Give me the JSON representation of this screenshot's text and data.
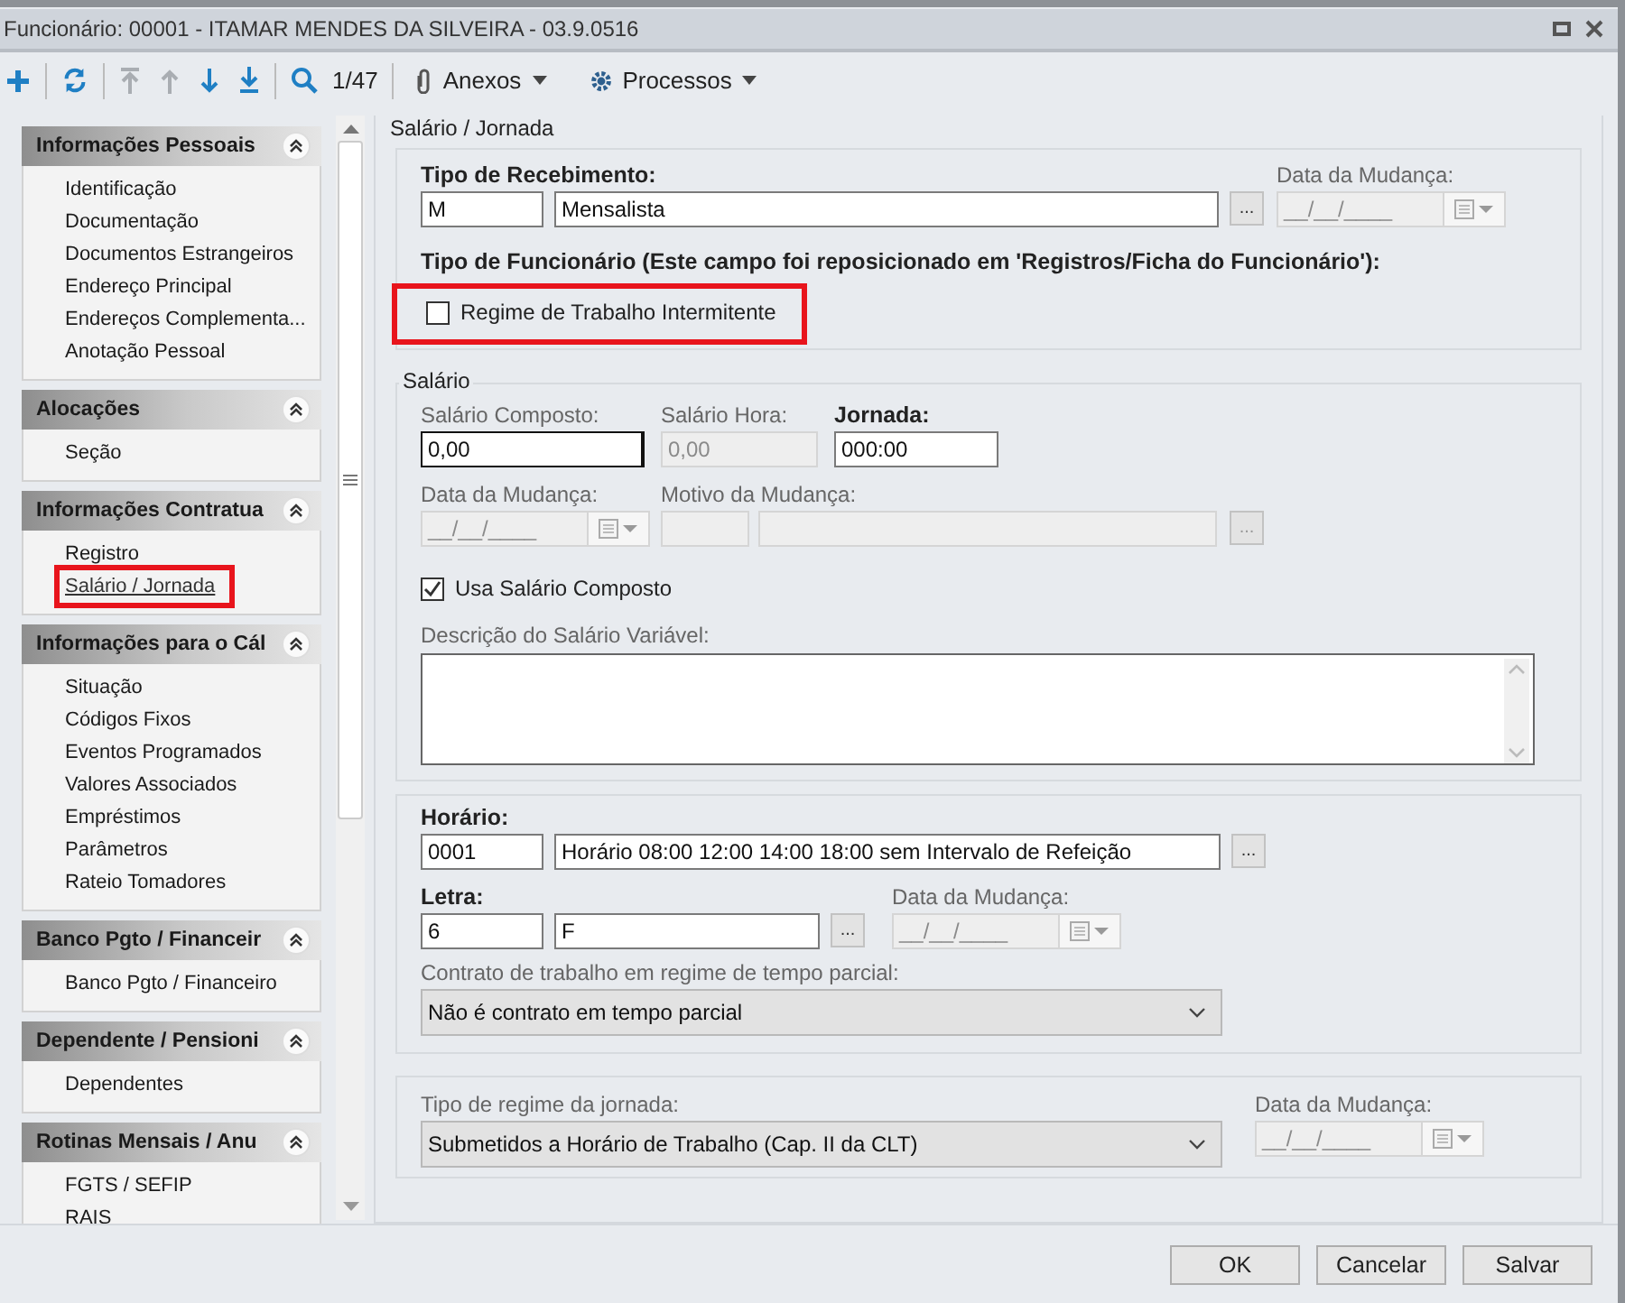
{
  "window": {
    "title": "Funcionário: 00001 - ITAMAR MENDES DA SILVEIRA - 03.9.0516"
  },
  "toolbar": [
    {
      "kind": "add",
      "disabled": false
    },
    {
      "kind": "refresh",
      "disabled": false
    },
    {
      "kind": "first",
      "disabled": true
    },
    {
      "kind": "previous",
      "disabled": true
    },
    {
      "kind": "next",
      "disabled": false
    },
    {
      "kind": "last",
      "disabled": false
    },
    {
      "kind": "search",
      "disabled": false
    },
    {
      "kind": "counter",
      "label": "1/47"
    },
    {
      "kind": "attachments",
      "label": "Anexos"
    },
    {
      "kind": "processes",
      "label": "Processos"
    }
  ],
  "sidebar": {
    "sections": [
      {
        "title": "Informações Pessoais",
        "expanded": true,
        "items": [
          {
            "label": "Identificação",
            "selected": false
          },
          {
            "label": "Documentação",
            "selected": false
          },
          {
            "label": "Documentos Estrangeiros",
            "selected": false
          },
          {
            "label": "Endereço Principal",
            "selected": false
          },
          {
            "label": "Endereços Complementa...",
            "selected": false
          },
          {
            "label": "Anotação Pessoal",
            "selected": false
          }
        ]
      },
      {
        "title": "Alocações",
        "expanded": true,
        "items": [
          {
            "label": "Seção",
            "selected": false
          }
        ]
      },
      {
        "title": "Informações Contratua",
        "expanded": true,
        "items": [
          {
            "label": "Registro",
            "selected": false
          },
          {
            "label": "Salário / Jornada",
            "selected": true,
            "highlighted": true
          }
        ]
      },
      {
        "title": "Informações para o Cál",
        "expanded": true,
        "items": [
          {
            "label": "Situação",
            "selected": false
          },
          {
            "label": "Códigos Fixos",
            "selected": false
          },
          {
            "label": "Eventos Programados",
            "selected": false
          },
          {
            "label": "Valores Associados",
            "selected": false
          },
          {
            "label": "Empréstimos",
            "selected": false
          },
          {
            "label": "Parâmetros",
            "selected": false
          },
          {
            "label": "Rateio Tomadores",
            "selected": false
          }
        ]
      },
      {
        "title": "Banco Pgto / Financeir",
        "expanded": true,
        "items": [
          {
            "label": "Banco Pgto / Financeiro",
            "selected": false
          }
        ]
      },
      {
        "title": "Dependente / Pensioni",
        "expanded": true,
        "items": [
          {
            "label": "Dependentes",
            "selected": false
          }
        ]
      },
      {
        "title": "Rotinas Mensais / Anu",
        "expanded": true,
        "items": [
          {
            "label": "FGTS / SEFIP",
            "selected": false
          },
          {
            "label": "RAIS",
            "selected": false
          }
        ]
      }
    ]
  },
  "form": {
    "legend": "Salário / Jornada",
    "recebimento": {
      "label": "Tipo de Recebimento:",
      "code": "M",
      "description": "Mensalista",
      "lookup": "...",
      "date_label": "Data da Mudança:",
      "date": "__/__/____"
    },
    "tipo_funcionario": {
      "label": "Tipo de Funcionário (Este campo foi reposicionado em 'Registros/Ficha do Funcionário'):",
      "checkbox": {
        "label": "Regime de Trabalho Intermitente",
        "checked": false,
        "highlighted": true
      }
    },
    "salario": {
      "legend": "Salário",
      "composto": {
        "label": "Salário Composto:",
        "value": "0,00"
      },
      "hora": {
        "label": "Salário Hora:",
        "value": "0,00",
        "disabled": true
      },
      "jornada": {
        "label": "Jornada:",
        "value": "000:00"
      },
      "date_label": "Data da Mudança:",
      "date": "__/__/____",
      "motivo_label": "Motivo da Mudança:",
      "lookup": "...",
      "usa_composto": {
        "label": "Usa Salário Composto",
        "checked": true
      },
      "descricao_label": "Descrição do Salário Variável:"
    },
    "horario": {
      "label": "Horário:",
      "code": "0001",
      "description": "Horário 08:00 12:00 14:00 18:00 sem Intervalo de Refeição",
      "lookup": "..."
    },
    "letra": {
      "label": "Letra:",
      "code": "6",
      "description": "F",
      "lookup": "...",
      "date_label": "Data da Mudança:",
      "date": "__/__/____"
    },
    "contrato": {
      "label": "Contrato de trabalho em regime de tempo parcial:",
      "value": "Não é contrato em tempo parcial"
    },
    "regime": {
      "label": "Tipo de regime da jornada:",
      "value": "Submetidos a Horário de Trabalho (Cap. II da CLT)",
      "date_label": "Data da Mudança:",
      "date": "__/__/____"
    }
  },
  "buttons": [
    "OK",
    "Cancelar",
    "Salvar"
  ]
}
